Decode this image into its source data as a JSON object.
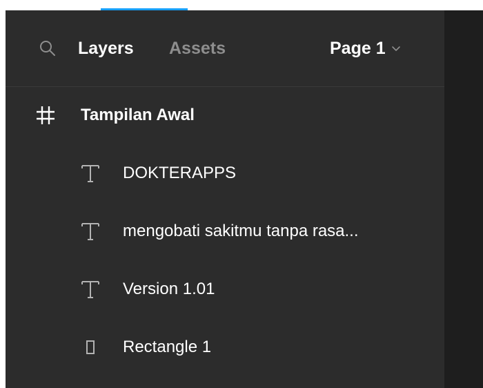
{
  "colors": {
    "panel_bg": "#2c2c2c",
    "canvas_bg": "#1e1e1e",
    "text_active": "#ffffff",
    "text_inactive": "#8e8e8e",
    "accent": "#18a0fb"
  },
  "header": {
    "search_icon": "search-icon",
    "tabs": [
      {
        "label": "Layers",
        "active": true
      },
      {
        "label": "Assets",
        "active": false
      }
    ],
    "page_selector": {
      "label": "Page 1",
      "icon": "chevron-down-icon"
    }
  },
  "layers": {
    "frame": {
      "icon": "frame-icon",
      "name": "Tampilan Awal"
    },
    "children": [
      {
        "icon": "text-icon",
        "name": "DOKTERAPPS"
      },
      {
        "icon": "text-icon",
        "name": "mengobati sakitmu tanpa rasa..."
      },
      {
        "icon": "text-icon",
        "name": "Version 1.01"
      },
      {
        "icon": "rectangle-icon",
        "name": "Rectangle 1"
      }
    ]
  }
}
